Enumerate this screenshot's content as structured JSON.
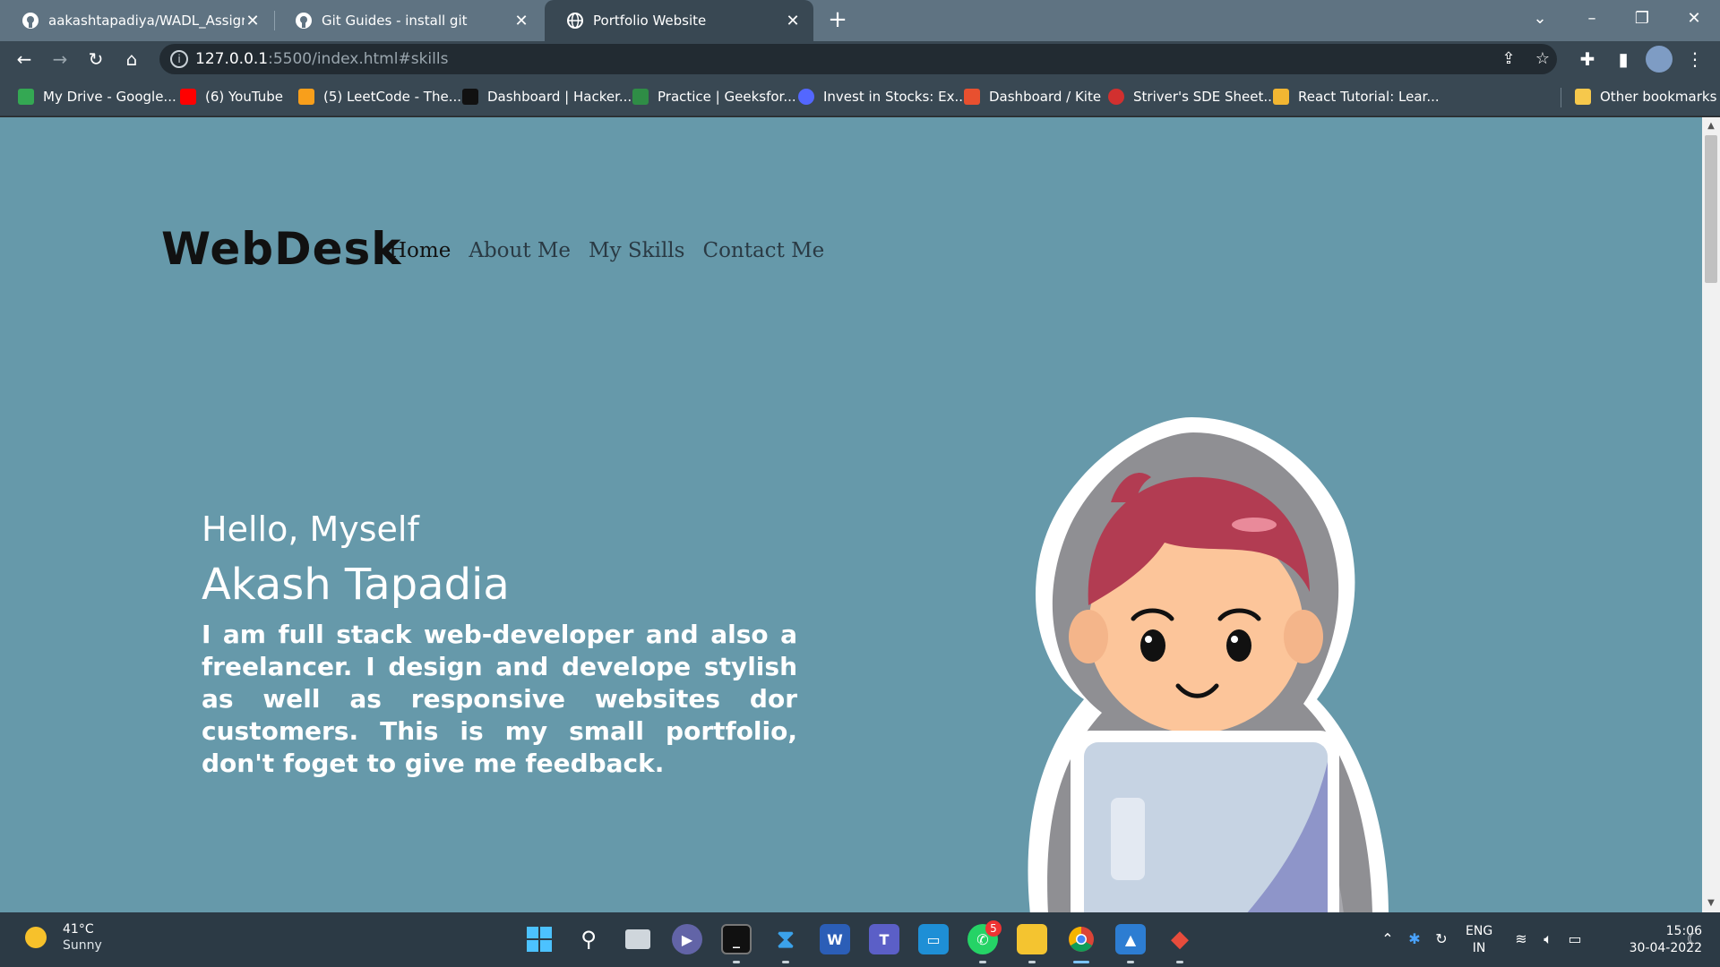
{
  "browser": {
    "tabs": [
      {
        "title": "aakashtapadiya/WADL_Assignme",
        "icon": "github-icon"
      },
      {
        "title": "Git Guides - install git",
        "icon": "github-icon"
      },
      {
        "title": "Portfolio Website",
        "icon": "globe-icon",
        "active": true
      }
    ],
    "url_host": "127.0.0.1",
    "url_path": ":5500/index.html#skills",
    "bookmarks": [
      {
        "label": "My Drive - Google...",
        "color": "#34a853"
      },
      {
        "label": "(6) YouTube",
        "color": "#ff0000"
      },
      {
        "label": "(5) LeetCode - The...",
        "color": "#f89f1b"
      },
      {
        "label": "Dashboard | Hacker...",
        "color": "#111111"
      },
      {
        "label": "Practice | Geeksfor...",
        "color": "#2f8d46"
      },
      {
        "label": "Invest in Stocks: Ex...",
        "color": "#5367ff"
      },
      {
        "label": "Dashboard / Kite",
        "color": "#e8502f"
      },
      {
        "label": "Striver's SDE Sheet...",
        "color": "#d2302f"
      },
      {
        "label": "React Tutorial: Lear...",
        "color": "#f2b632"
      }
    ],
    "other_bookmarks": "Other bookmarks"
  },
  "page": {
    "logo": "WebDesk",
    "nav": [
      "Home",
      "About Me",
      "My Skills",
      "Contact Me"
    ],
    "greeting": "Hello, Myself",
    "name": "Akash Tapadia",
    "bio": "I am full stack web-developer and also a freelancer. I design and develope stylish as well as responsive websites dor customers. This is my small portfolio, don't foget to give me feedback.",
    "background_color": "#6699aa"
  },
  "taskbar": {
    "weather_temp": "41°C",
    "weather_cond": "Sunny",
    "lang_top": "ENG",
    "lang_bottom": "IN",
    "time": "15:06",
    "date": "30-04-2022",
    "whatsapp_badge": "5"
  }
}
